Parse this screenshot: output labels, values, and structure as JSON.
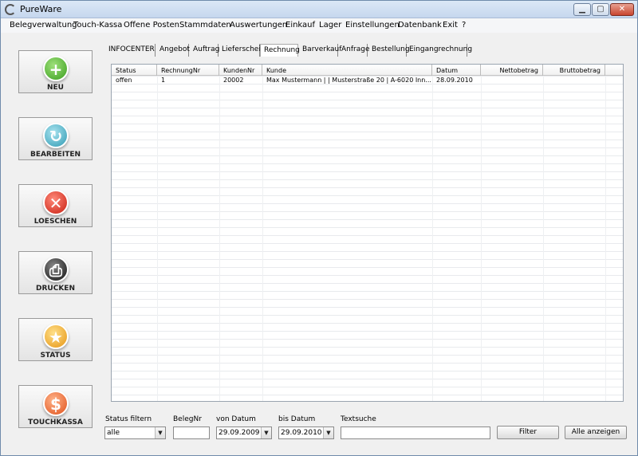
{
  "window": {
    "title": "PureWare"
  },
  "menu": [
    "Belegverwaltung",
    "Touch-Kassa",
    "Offene Posten",
    "Stammdaten",
    "Auswertungen",
    "Einkauf",
    "Lager",
    "Einstellungen",
    "Datenbank",
    "Exit",
    "?"
  ],
  "sidebar": [
    {
      "label": "NEU",
      "icon": "plus-icon",
      "glyph": "+",
      "color": "green"
    },
    {
      "label": "BEARBEITEN",
      "icon": "refresh-icon",
      "glyph": "↻",
      "color": "blue"
    },
    {
      "label": "LOESCHEN",
      "icon": "delete-x-icon",
      "glyph": "✕",
      "color": "red"
    },
    {
      "label": "DRUCKEN",
      "icon": "printer-icon",
      "glyph": "⎙",
      "color": "black"
    },
    {
      "label": "STATUS",
      "icon": "star-icon",
      "glyph": "★",
      "color": "yellow"
    },
    {
      "label": "TOUCHKASSA",
      "icon": "dollar-icon",
      "glyph": "$",
      "color": "orange"
    }
  ],
  "tabs": [
    "INFOCENTER",
    "Angebot",
    "Auftrag",
    "Lieferschein",
    "Rechnung",
    "Barverkauf",
    "Anfrage",
    "Bestellung",
    "Eingangrechnung"
  ],
  "active_tab": "Rechnung",
  "table": {
    "columns": [
      "Status",
      "RechnungNr",
      "KundenNr",
      "Kunde",
      "Datum",
      "Nettobetrag",
      "Bruttobetrag"
    ],
    "rows": [
      [
        "offen",
        "1",
        "20002",
        "Max Mustermann |  | Musterstraße 20 | A-6020 Inn...",
        "28.09.2010",
        "",
        ""
      ]
    ]
  },
  "filters": {
    "status_label": "Status filtern",
    "status_value": "alle",
    "belegnr_label": "BelegNr",
    "von_label": "von Datum",
    "von_value": "29.09.2009",
    "bis_label": "bis Datum",
    "bis_value": "29.09.2010",
    "text_label": "Textsuche",
    "filter_button": "Filter",
    "show_all_button": "Alle anzeigen"
  }
}
